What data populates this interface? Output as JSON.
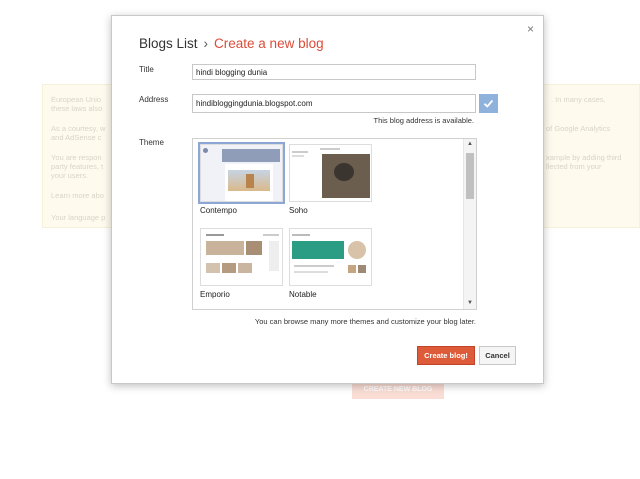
{
  "background": {
    "notice_lines": [
      "European Unio",
      "these laws also",
      "As a courtesy, w",
      "and AdSense c",
      "You are respon",
      "party features, t",
      "your users.",
      "Learn more abo",
      "Your language p"
    ],
    "notice_right_lines": [
      ". In many cases,",
      "of Google Analytics",
      "xample by adding third",
      "llected from your"
    ],
    "create_button_label": "CREATE NEW BLOG"
  },
  "dialog": {
    "close_icon": "×",
    "breadcrumb_root": "Blogs List",
    "breadcrumb_sep": "›",
    "breadcrumb_current": "Create a new blog",
    "title_label": "Title",
    "title_value": "hindi blogging dunia",
    "address_label": "Address",
    "address_value": "hindibloggingdunia.blogspot.com",
    "availability": "This blog address is available.",
    "theme_label": "Theme",
    "themes": [
      {
        "name": "Contempo",
        "selected": true
      },
      {
        "name": "Soho",
        "selected": false
      },
      {
        "name": "Emporio",
        "selected": false
      },
      {
        "name": "Notable",
        "selected": false
      }
    ],
    "themes_hint": "You can browse many more themes and customize your blog later.",
    "create_button": "Create blog!",
    "cancel_button": "Cancel",
    "accent_color": "#dd4b39"
  }
}
